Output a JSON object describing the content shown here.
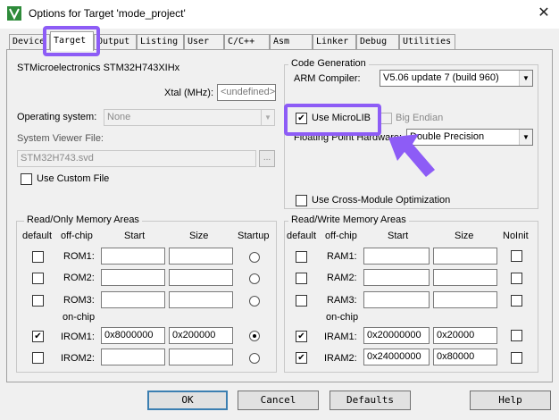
{
  "window": {
    "title": "Options for Target 'mode_project'",
    "close_icon": "✕"
  },
  "tabs": [
    {
      "label": "Device"
    },
    {
      "label": "Target"
    },
    {
      "label": "Output"
    },
    {
      "label": "Listing"
    },
    {
      "label": "User"
    },
    {
      "label": "C/C++"
    },
    {
      "label": "Asm"
    },
    {
      "label": "Linker"
    },
    {
      "label": "Debug"
    },
    {
      "label": "Utilities"
    }
  ],
  "device": {
    "name": "STMicroelectronics STM32H743XIHx",
    "xtal_label": "Xtal (MHz):",
    "xtal_value": "<undefined>",
    "os_label": "Operating system:",
    "os_value": "None",
    "svf_label": "System Viewer File:",
    "svf_value": "STM32H743.svd",
    "browse_label": "...",
    "custom_file_label": "Use Custom File"
  },
  "code_generation": {
    "title": "Code Generation",
    "compiler_label": "ARM Compiler:",
    "compiler_value": "V5.06 update 7 (build 960)",
    "microlib_label": "Use MicroLIB",
    "microlib_checked": true,
    "big_endian_label": "Big Endian",
    "fpu_label": "Floating Point Hardware:",
    "fpu_value": "Double Precision",
    "cross_module_label": "Use Cross-Module Optimization"
  },
  "ro_memory": {
    "title": "Read/Only Memory Areas",
    "headers": {
      "default": "default",
      "offchip": "off-chip",
      "start": "Start",
      "size": "Size",
      "startup": "Startup"
    },
    "onchip_label": "on-chip",
    "rows": [
      {
        "name": "ROM1:",
        "start": "",
        "size": "",
        "default": false,
        "startup": false
      },
      {
        "name": "ROM2:",
        "start": "",
        "size": "",
        "default": false,
        "startup": false
      },
      {
        "name": "ROM3:",
        "start": "",
        "size": "",
        "default": false,
        "startup": false
      },
      {
        "name": "IROM1:",
        "start": "0x8000000",
        "size": "0x200000",
        "default": true,
        "startup": true
      },
      {
        "name": "IROM2:",
        "start": "",
        "size": "",
        "default": false,
        "startup": false
      }
    ]
  },
  "rw_memory": {
    "title": "Read/Write Memory Areas",
    "headers": {
      "default": "default",
      "offchip": "off-chip",
      "start": "Start",
      "size": "Size",
      "noinit": "NoInit"
    },
    "onchip_label": "on-chip",
    "rows": [
      {
        "name": "RAM1:",
        "start": "",
        "size": "",
        "default": false,
        "noinit": false
      },
      {
        "name": "RAM2:",
        "start": "",
        "size": "",
        "default": false,
        "noinit": false
      },
      {
        "name": "RAM3:",
        "start": "",
        "size": "",
        "default": false,
        "noinit": false
      },
      {
        "name": "IRAM1:",
        "start": "0x20000000",
        "size": "0x20000",
        "default": true,
        "noinit": false
      },
      {
        "name": "IRAM2:",
        "start": "0x24000000",
        "size": "0x80000",
        "default": true,
        "noinit": false
      }
    ]
  },
  "buttons": {
    "ok": "OK",
    "cancel": "Cancel",
    "defaults": "Defaults",
    "help": "Help"
  },
  "highlight_color": "#8d5cf6"
}
